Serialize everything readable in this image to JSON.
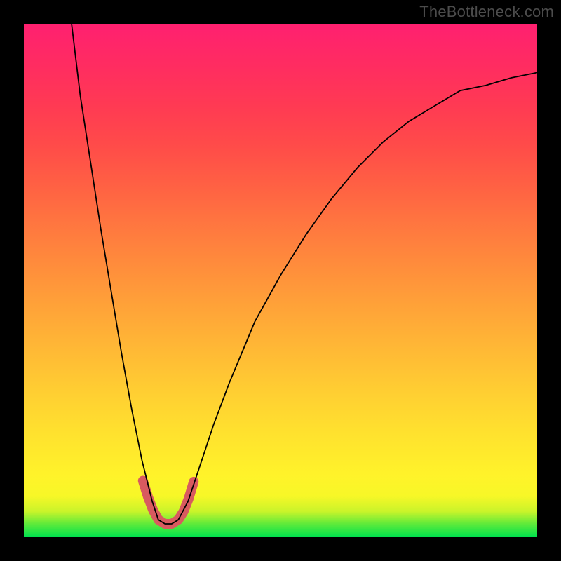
{
  "watermark": "TheBottleneck.com",
  "colors": {
    "page_bg": "#000000",
    "valley_stroke": "#d85a5f",
    "curve_stroke": "#000000",
    "gradient_top": "#ff2070",
    "gradient_bottom": "#00e24e"
  },
  "chart_data": {
    "type": "line",
    "title": "",
    "xlabel": "",
    "ylabel": "",
    "xlim": [
      0,
      1
    ],
    "ylim": [
      0,
      1
    ],
    "note": "Axes unlabeled in source image; x/y are normalized 0–1 over the 732×732 plot area. y=0 is the green bottom; y increases toward the red top.",
    "series": [
      {
        "name": "curve",
        "x": [
          0.093,
          0.11,
          0.13,
          0.15,
          0.17,
          0.19,
          0.21,
          0.23,
          0.25,
          0.262,
          0.275,
          0.288,
          0.301,
          0.32,
          0.34,
          0.37,
          0.4,
          0.45,
          0.5,
          0.55,
          0.6,
          0.65,
          0.7,
          0.75,
          0.8,
          0.85,
          0.9,
          0.95,
          1.0
        ],
        "y": [
          1.0,
          0.86,
          0.73,
          0.6,
          0.48,
          0.36,
          0.25,
          0.15,
          0.07,
          0.034,
          0.026,
          0.026,
          0.034,
          0.07,
          0.13,
          0.22,
          0.3,
          0.42,
          0.51,
          0.59,
          0.66,
          0.72,
          0.77,
          0.81,
          0.84,
          0.87,
          0.88,
          0.895,
          0.905
        ]
      },
      {
        "name": "valley-highlight",
        "x": [
          0.232,
          0.242,
          0.252,
          0.262,
          0.275,
          0.288,
          0.301,
          0.311,
          0.321,
          0.331
        ],
        "y": [
          0.11,
          0.078,
          0.052,
          0.034,
          0.026,
          0.026,
          0.034,
          0.05,
          0.075,
          0.108
        ]
      }
    ],
    "legend": false
  }
}
